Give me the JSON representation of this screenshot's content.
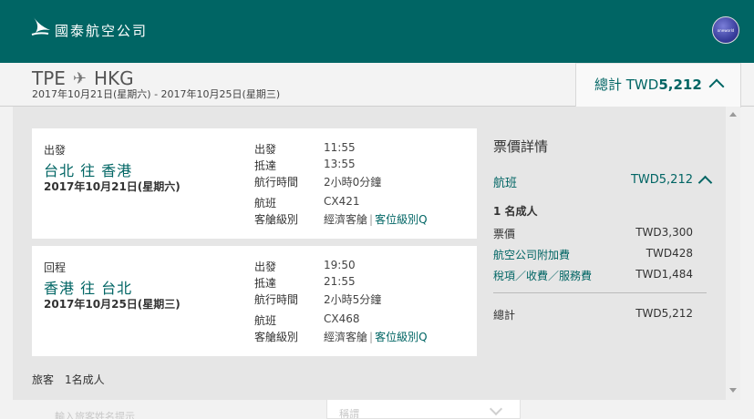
{
  "header": {
    "brand": "國泰航空公司",
    "alliance_logo_text": "oneworld"
  },
  "summary": {
    "origin": "TPE",
    "destination": "HKG",
    "dates": "2017年10月21日(星期六) - 2017年10月25日(星期三)",
    "total_label": "總計 TWD",
    "total_amount": "5,212"
  },
  "outbound": {
    "direction": "出發",
    "route": "台北 往 香港",
    "date": "2017年10月21日(星期六)",
    "depart_label": "出發",
    "depart_time": "11:55",
    "arrive_label": "抵達",
    "arrive_time": "13:55",
    "duration_label": "航行時間",
    "duration": "2小時0分鐘",
    "flight_label": "航班",
    "flight": "CX421",
    "cabin_label": "客艙級別",
    "cabin": "經濟客艙",
    "class_link": "客位級別Q"
  },
  "inbound": {
    "direction": "回程",
    "route": "香港 往 台北",
    "date": "2017年10月25日(星期三)",
    "depart_label": "出發",
    "depart_time": "19:50",
    "arrive_label": "抵達",
    "arrive_time": "21:55",
    "duration_label": "航行時間",
    "duration": "2小時5分鐘",
    "flight_label": "航班",
    "flight": "CX468",
    "cabin_label": "客艙級別",
    "cabin": "經濟客艙",
    "class_link": "客位級別Q"
  },
  "fare": {
    "title": "票價詳情",
    "flight_label": "航班",
    "flight_total": "TWD5,212",
    "adults": "1 名成人",
    "rows": [
      {
        "label": "票價",
        "value": "TWD3,300"
      },
      {
        "label": "航空公司附加費",
        "value": "TWD428"
      },
      {
        "label": "稅項／收費／服務費",
        "value": "TWD1,484"
      }
    ],
    "total_label": "總計",
    "total": "TWD5,212"
  },
  "passengers": "旅客　1名成人",
  "below": {
    "faded_left": "輸入旅客姓名提示",
    "faded_box": "稱謂"
  }
}
